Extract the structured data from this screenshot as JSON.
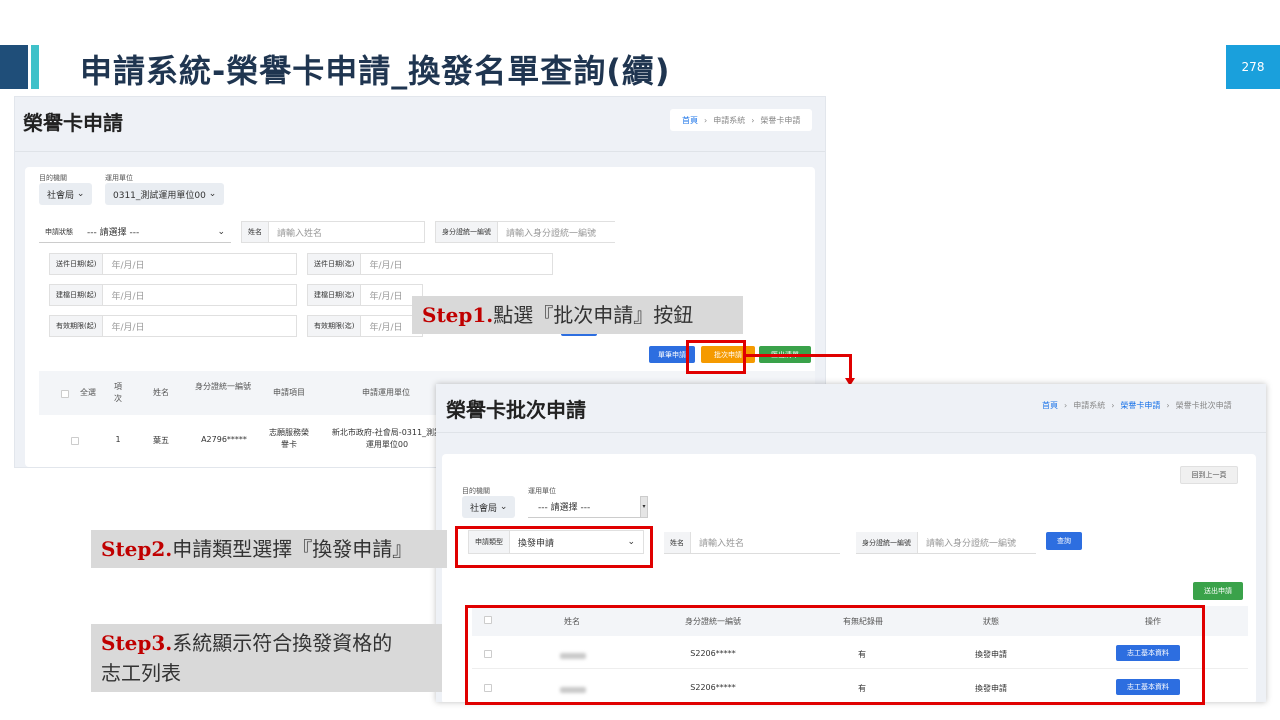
{
  "header": {
    "title": "申請系統-榮譽卡申請_換發名單查詢(續)",
    "page_number": "278",
    "colors": {
      "bar_dark": "#1f4e79",
      "bar_teal": "#3fc1c9",
      "title": "#1f3550",
      "page_badge": "#1aa0dc"
    }
  },
  "shot1": {
    "title": "榮譽卡申請",
    "breadcrumb": [
      "首頁",
      "申請系統",
      "榮譽卡申請"
    ],
    "breadcrumb_sep": "›",
    "filters": {
      "dest_label": "目的機關",
      "dest_value": "社會局",
      "unit_label": "運用單位",
      "unit_value": "0311_測試運用單位00",
      "apply_status_label": "申請狀態",
      "apply_status_value": "--- 請選擇 ---",
      "name_label": "姓名",
      "name_placeholder": "請輸入姓名",
      "id_label": "身分證統一編號",
      "id_placeholder": "請輸入身分證統一編號",
      "date_fields": [
        {
          "label": "送件日期(起)",
          "value": "年/月/日"
        },
        {
          "label": "送件日期(迄)",
          "value": "年/月/日"
        },
        {
          "label": "建檔日期(起)",
          "value": "年/月/日"
        },
        {
          "label": "建檔日期(迄)",
          "value": "年/月/日"
        },
        {
          "label": "有效期限(起)",
          "value": "年/月/日"
        },
        {
          "label": "有效期限(迄)",
          "value": "年/月/日"
        }
      ]
    },
    "buttons": {
      "single": "單筆申請",
      "batch": "批次申請",
      "export": "匯出清單"
    },
    "table": {
      "headers": [
        "全選",
        "項次",
        "姓名",
        "身分證統一編號",
        "申請項目",
        "申請運用單位"
      ],
      "row": {
        "index": "1",
        "name": "葉五",
        "id": "A2796*****",
        "item": "志願服務榮譽卡",
        "unit": "新北市政府-社會局-0311_測試運用單位00"
      }
    }
  },
  "callouts": {
    "step1_num": "Step1.",
    "step1_text": "點選『批次申請』按鈕",
    "step2_num": "Step2.",
    "step2_text": "申請類型選擇『換發申請』",
    "step3_num": "Step3.",
    "step3_text_line1": "系統顯示符合換發資格的",
    "step3_text_line2": "志工列表"
  },
  "shot2": {
    "title": "榮譽卡批次申請",
    "breadcrumb": [
      "首頁",
      "申請系統",
      "榮譽卡申請",
      "榮譽卡批次申請"
    ],
    "back_label": "回到上一頁",
    "dest_label": "目的機關",
    "dest_value": "社會局",
    "unit_label": "運用單位",
    "unit_value": "--- 請選擇 ---",
    "type_label": "申請類型",
    "type_value": "換發申請",
    "name_label": "姓名",
    "name_placeholder": "請輸入姓名",
    "id_label": "身分證統一編號",
    "id_placeholder": "請輸入身分證統一編號",
    "search_label": "查詢",
    "batch_label": "送出申請",
    "table": {
      "headers": [
        "姓名",
        "身分證統一編號",
        "有無紀錄冊",
        "狀態",
        "操作"
      ],
      "rows": [
        {
          "id": "S2206*****",
          "record": "有",
          "status": "換發申請",
          "action": "志工基本資料"
        },
        {
          "id": "S2206*****",
          "record": "有",
          "status": "換發申請",
          "action": "志工基本資料"
        }
      ]
    }
  }
}
